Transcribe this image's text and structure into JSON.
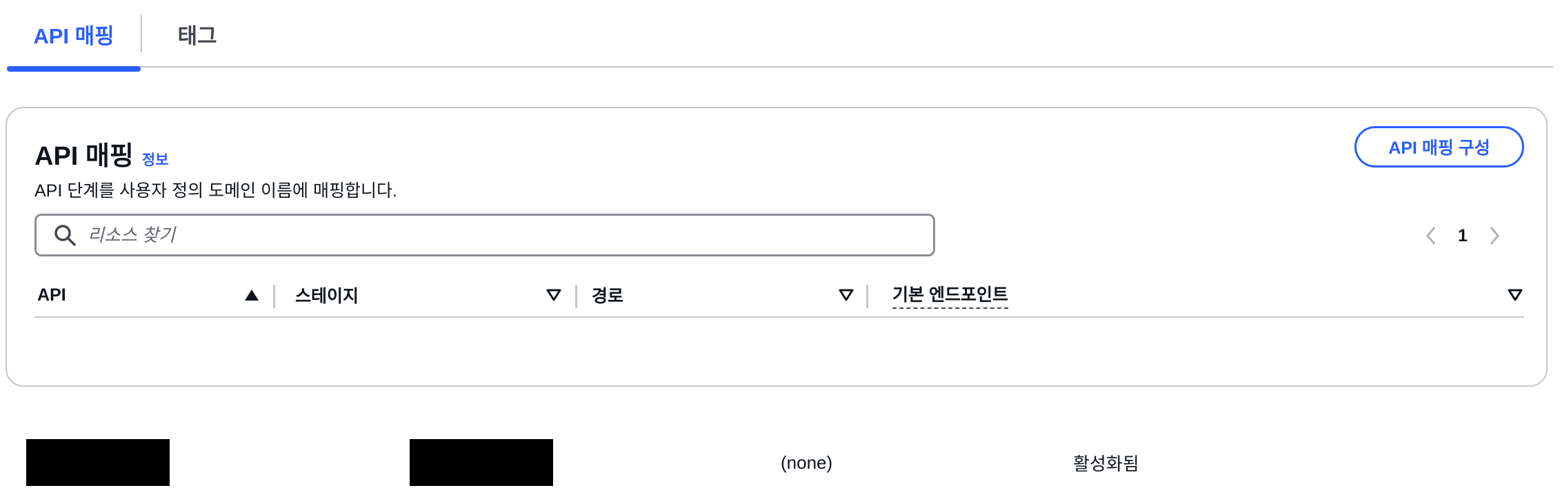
{
  "tabs": [
    {
      "label": "API 매핑",
      "active": true
    },
    {
      "label": "태그",
      "active": false
    }
  ],
  "panel": {
    "title": "API 매핑",
    "info_link": "정보",
    "description": "API 단계를 사용자 정의 도메인 이름에 매핑합니다.",
    "config_button": "API 매핑 구성"
  },
  "search": {
    "placeholder": "리소스 찾기",
    "value": ""
  },
  "pagination": {
    "current_page": "1"
  },
  "table": {
    "columns": [
      {
        "label": "API",
        "sort": "ascending"
      },
      {
        "label": "스테이지",
        "sort": "none"
      },
      {
        "label": "경로",
        "sort": "none"
      },
      {
        "label": "기본 엔드포인트",
        "sort": "none"
      }
    ],
    "rows": [
      {
        "api": "",
        "stage": "",
        "path": "(none)",
        "default_endpoint": "활성화됨"
      }
    ]
  },
  "colors": {
    "accent": "#295eff",
    "border": "#c6c6cd",
    "text": "#0f141a"
  }
}
